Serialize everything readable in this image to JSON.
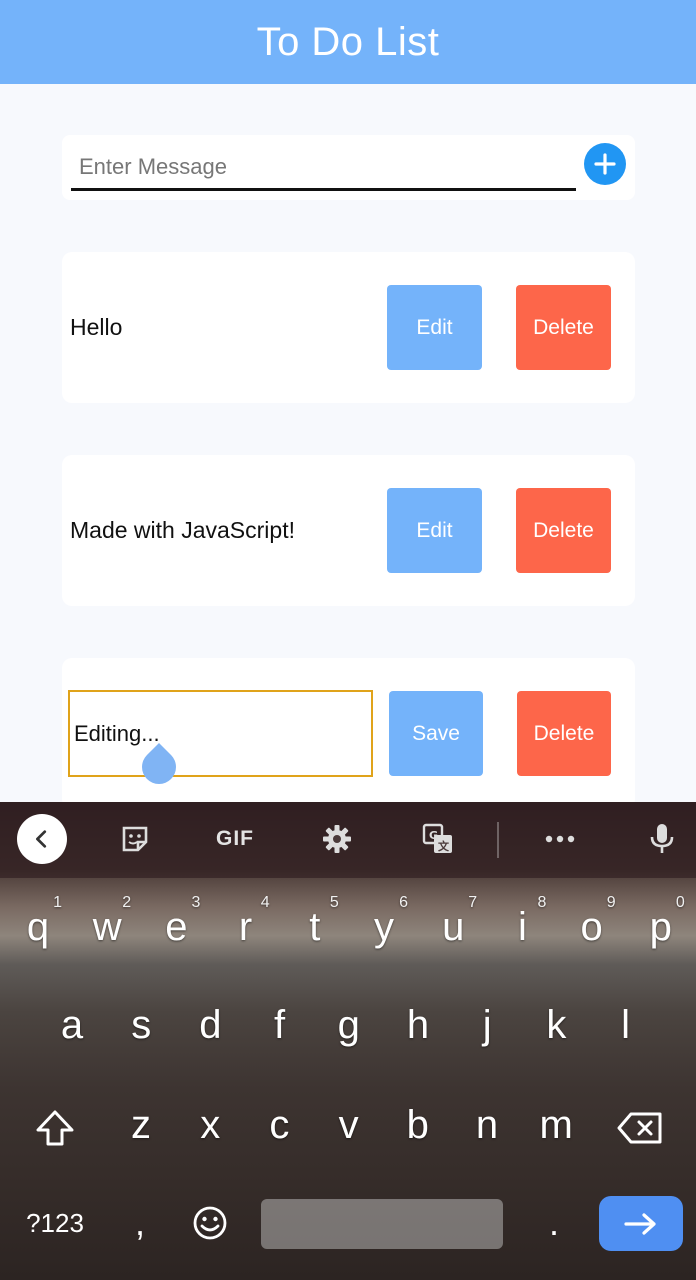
{
  "app": {
    "title": "To Do List"
  },
  "input": {
    "placeholder": "Enter Message",
    "add_icon": "plus-circle-icon"
  },
  "todos": [
    {
      "text": "Hello",
      "edit_label": "Edit",
      "delete_label": "Delete"
    },
    {
      "text": "Made with JavaScript!",
      "edit_label": "Edit",
      "delete_label": "Delete"
    },
    {
      "text": "Editing...",
      "save_label": "Save",
      "delete_label": "Delete",
      "editing": true
    }
  ],
  "colors": {
    "header": "#74b3fa",
    "edit_button": "#74b3fa",
    "delete_button": "#fd664a",
    "add_button": "#2196f3",
    "edit_border": "#e0a31a"
  },
  "keyboard": {
    "toolbar": {
      "gif": "GIF"
    },
    "row1": [
      {
        "k": "q",
        "h": "1"
      },
      {
        "k": "w",
        "h": "2"
      },
      {
        "k": "e",
        "h": "3"
      },
      {
        "k": "r",
        "h": "4"
      },
      {
        "k": "t",
        "h": "5"
      },
      {
        "k": "y",
        "h": "6"
      },
      {
        "k": "u",
        "h": "7"
      },
      {
        "k": "i",
        "h": "8"
      },
      {
        "k": "o",
        "h": "9"
      },
      {
        "k": "p",
        "h": "0"
      }
    ],
    "row2": [
      "a",
      "s",
      "d",
      "f",
      "g",
      "h",
      "j",
      "k",
      "l"
    ],
    "row3": [
      "z",
      "x",
      "c",
      "v",
      "b",
      "n",
      "m"
    ],
    "symbols": "?123",
    "comma": ",",
    "period": "."
  }
}
